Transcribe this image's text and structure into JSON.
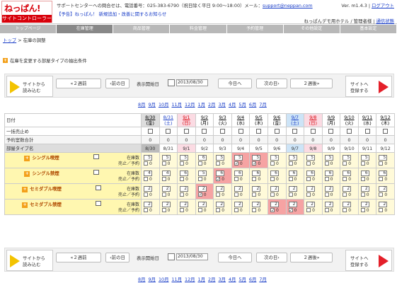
{
  "logo": {
    "top": "ねっぱん!",
    "bottom": "サイトコントローラー"
  },
  "support": {
    "text": "サポートセンターへの問合せは、電話番号：025-383-6790（祝日除く平日 9:00〜18:00）メール：",
    "mail": "support@neppan.com"
  },
  "announce": "【予告】ねっぱん！ 新規追加・改善に関するお知らせ",
  "version": {
    "label": "Ver. m1.4.3",
    "logout": "ログアウト"
  },
  "user": {
    "name": "ねっぱんデモ用ホテル / 管理者様",
    "mode": "通信状態"
  },
  "nav": [
    "トップページ",
    "在庫管理",
    "商品管理",
    "料金管理",
    "予約管理",
    "その他設定",
    "基本設定"
  ],
  "breadcrumb": {
    "top": "トップ",
    "current": "在庫の調整"
  },
  "conditions": "在庫を変更する部屋タイプの抽出条件",
  "toolbar": {
    "load": "サイトから\n読み込む",
    "register": "サイトへ\n登録する",
    "prev2": "«２週前",
    "prev1": "‹前の日",
    "startLabel": "表示開始日",
    "date": "2013/08/30",
    "today": "今日へ",
    "next1": "次の日›",
    "next2": "２週後»"
  },
  "months": [
    "8月",
    "9月",
    "10月",
    "11月",
    "12月",
    "1月",
    "2月",
    "3月",
    "4月",
    "5月",
    "6月",
    "7月"
  ],
  "grid": {
    "dateLabel": "日付",
    "stopLabel": "一括売止め",
    "resvLabel": "予約室数合計",
    "roomLabel": "部屋タイプ名",
    "days": [
      {
        "d": "8/30",
        "w": "(金)",
        "c": "#000"
      },
      {
        "d": "8/31",
        "w": "(土)",
        "c": "#1a3ec8"
      },
      {
        "d": "9/1",
        "w": "(日)",
        "c": "#d8000a"
      },
      {
        "d": "9/2",
        "w": "(月)",
        "c": "#000"
      },
      {
        "d": "9/3",
        "w": "(火)",
        "c": "#000"
      },
      {
        "d": "9/4",
        "w": "(水)",
        "c": "#000"
      },
      {
        "d": "9/5",
        "w": "(木)",
        "c": "#000"
      },
      {
        "d": "9/6",
        "w": "(金)",
        "c": "#000"
      },
      {
        "d": "9/7",
        "w": "(土)",
        "c": "#1a3ec8"
      },
      {
        "d": "9/8",
        "w": "(日)",
        "c": "#d8000a"
      },
      {
        "d": "9/9",
        "w": "(月)",
        "c": "#000"
      },
      {
        "d": "9/10",
        "w": "(火)",
        "c": "#000"
      },
      {
        "d": "9/11",
        "w": "(水)",
        "c": "#000"
      },
      {
        "d": "9/12",
        "w": "(木)",
        "c": "#000"
      }
    ],
    "reservations": [
      "0",
      "0",
      "0",
      "0",
      "0",
      "0",
      "0",
      "0",
      "0",
      "0",
      "0",
      "0",
      "0",
      "0"
    ],
    "rows": [
      {
        "name": "シングル喫煙",
        "stock": [
          "5",
          "5",
          "5",
          "6",
          "5",
          "5",
          "5",
          "5",
          "5",
          "5",
          "5",
          "5",
          "5",
          "5"
        ],
        "sold": [
          "0",
          "0",
          "0",
          "0",
          "0",
          "0",
          "0",
          "0",
          "0",
          "0",
          "0",
          "0",
          "0",
          "0"
        ],
        "hl": [
          5,
          6
        ]
      },
      {
        "name": "シングル禁煙",
        "stock": [
          "4",
          "4",
          "6",
          "5",
          "6",
          "6",
          "6",
          "6",
          "6",
          "6",
          "6",
          "6",
          "6",
          "6"
        ],
        "sold": [
          "0",
          "0",
          "0",
          "0",
          "0",
          "0",
          "0",
          "0",
          "0",
          "0",
          "0",
          "0",
          "0",
          "0"
        ],
        "hl": [
          4
        ]
      },
      {
        "name": "セミダブル喫煙",
        "stock": [
          "2",
          "2",
          "2",
          "2",
          "2",
          "2",
          "2",
          "2",
          "2",
          "2",
          "2",
          "2",
          "2",
          "2"
        ],
        "sold": [
          "0",
          "0",
          "0",
          "0",
          "0",
          "0",
          "0",
          "0",
          "0",
          "0",
          "0",
          "0",
          "0",
          "0"
        ],
        "hl": [
          3
        ]
      },
      {
        "name": "セミダブル禁煙",
        "stock": [
          "2",
          "2",
          "2",
          "2",
          "2",
          "2",
          "2",
          "2",
          "2",
          "2",
          "2",
          "2",
          "2",
          "2"
        ],
        "sold": [
          "0",
          "0",
          "0",
          "0",
          "0",
          "0",
          "0",
          "0",
          "0",
          "0",
          "0",
          "0",
          "0",
          "0"
        ],
        "hl": [
          7,
          8
        ]
      }
    ],
    "stockLabel": "在庫数",
    "soldLabel": "売止／予約"
  }
}
